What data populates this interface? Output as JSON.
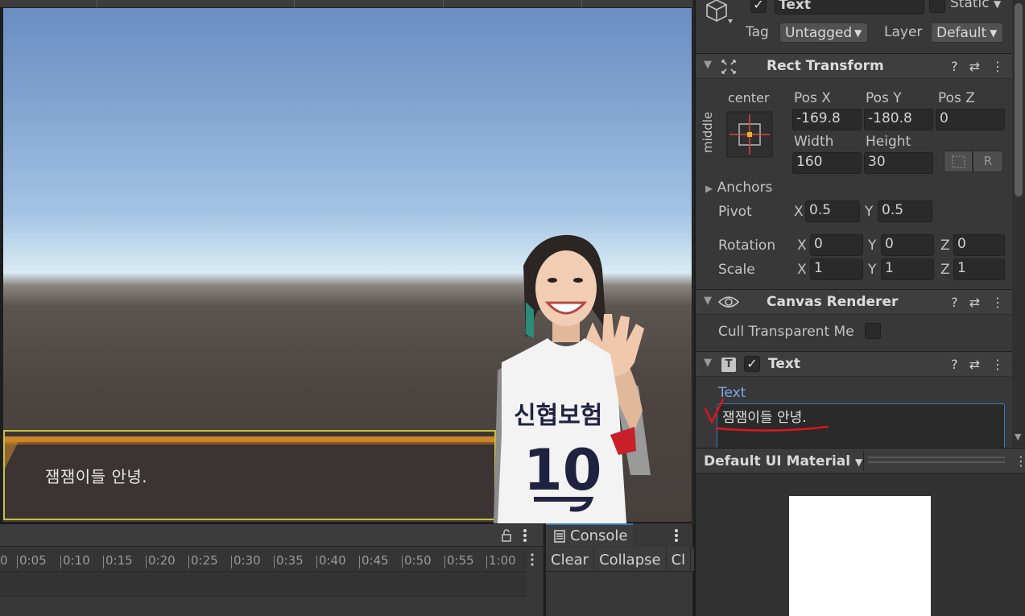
{
  "game": {
    "dialog_text": "잼잼이들 안녕.",
    "jersey_sponsor": "신협보험",
    "jersey_number": "10"
  },
  "timeline": {
    "ticks": [
      "0",
      "0:05",
      "0:10",
      "0:15",
      "0:20",
      "0:25",
      "0:30",
      "0:35",
      "0:40",
      "0:45",
      "0:50",
      "0:55",
      "1:00"
    ]
  },
  "console": {
    "tab_label": "Console",
    "buttons": [
      "Clear",
      "Collapse",
      "Cl"
    ]
  },
  "inspector": {
    "object": {
      "active": true,
      "name": "Text",
      "static_label": "Static",
      "tag_label": "Tag",
      "tag_value": "Untagged",
      "layer_label": "Layer",
      "layer_value": "Default"
    },
    "rect_transform": {
      "title": "Rect Transform",
      "anchor_h": "center",
      "anchor_v": "middle",
      "pos_x_label": "Pos X",
      "pos_y_label": "Pos Y",
      "pos_z_label": "Pos Z",
      "pos_x": "-169.8",
      "pos_y": "-180.8",
      "pos_z": "0",
      "width_label": "Width",
      "height_label": "Height",
      "width": "160",
      "height": "30",
      "raw_button": "R",
      "anchors_label": "Anchors",
      "pivot_label": "Pivot",
      "pivot_x": "0.5",
      "pivot_y": "0.5",
      "rotation_label": "Rotation",
      "rot_x": "0",
      "rot_y": "0",
      "rot_z": "0",
      "scale_label": "Scale",
      "scale_x": "1",
      "scale_y": "1",
      "scale_z": "1",
      "x": "X",
      "y": "Y",
      "z": "Z"
    },
    "canvas_renderer": {
      "title": "Canvas Renderer",
      "cull_label": "Cull Transparent Me",
      "cull_checked": false
    },
    "text_component": {
      "title": "Text",
      "enabled": true,
      "field_label": "Text",
      "value": "잼잼이들 안녕."
    },
    "material": {
      "name": "Default UI Material"
    }
  },
  "colors": {
    "accent_blue": "#3a79bb",
    "annotation_red": "#e0141e"
  }
}
